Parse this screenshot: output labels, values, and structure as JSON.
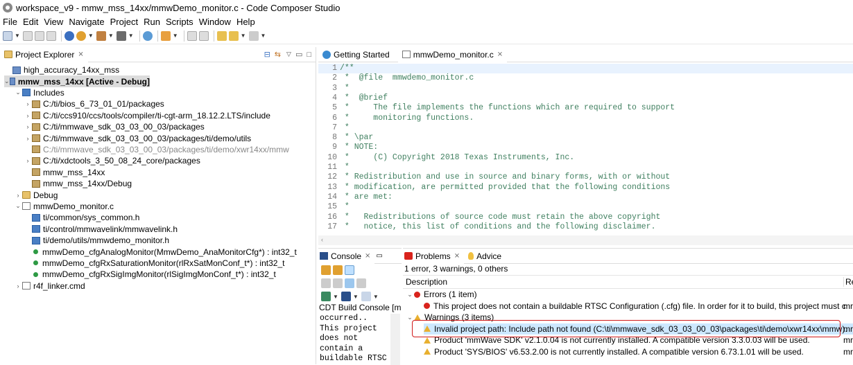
{
  "window": {
    "title": "workspace_v9 - mmw_mss_14xx/mmwDemo_monitor.c - Code Composer Studio"
  },
  "menu": [
    "File",
    "Edit",
    "View",
    "Navigate",
    "Project",
    "Run",
    "Scripts",
    "Window",
    "Help"
  ],
  "project_explorer": {
    "title": "Project Explorer",
    "items": [
      {
        "label": "high_accuracy_14xx_mss",
        "indent": 0,
        "arrow": "",
        "icon": "proj"
      },
      {
        "label": "mmw_mss_14xx  [Active - Debug]",
        "indent": 0,
        "arrow": "v",
        "icon": "proj",
        "bold": true
      },
      {
        "label": "Includes",
        "indent": 1,
        "arrow": "v",
        "icon": "inc"
      },
      {
        "label": "C:/ti/bios_6_73_01_01/packages",
        "indent": 2,
        "arrow": ">",
        "icon": "lib"
      },
      {
        "label": "C:/ti/ccs910/ccs/tools/compiler/ti-cgt-arm_18.12.2.LTS/include",
        "indent": 2,
        "arrow": ">",
        "icon": "lib"
      },
      {
        "label": "C:/ti/mmwave_sdk_03_03_00_03/packages",
        "indent": 2,
        "arrow": ">",
        "icon": "lib"
      },
      {
        "label": "C:/ti/mmwave_sdk_03_03_00_03/packages/ti/demo/utils",
        "indent": 2,
        "arrow": ">",
        "icon": "lib"
      },
      {
        "label": "C:/ti/mmwave_sdk_03_03_00_03/packages/ti/demo/xwr14xx/mmw",
        "indent": 2,
        "arrow": "",
        "icon": "lib",
        "grey": true
      },
      {
        "label": "C:/ti/xdctools_3_50_08_24_core/packages",
        "indent": 2,
        "arrow": ">",
        "icon": "lib"
      },
      {
        "label": "mmw_mss_14xx",
        "indent": 2,
        "arrow": "",
        "icon": "lib"
      },
      {
        "label": "mmw_mss_14xx/Debug",
        "indent": 2,
        "arrow": "",
        "icon": "lib"
      },
      {
        "label": "Debug",
        "indent": 1,
        "arrow": ">",
        "icon": "folder"
      },
      {
        "label": "mmwDemo_monitor.c",
        "indent": 1,
        "arrow": "v",
        "icon": "file"
      },
      {
        "label": "ti/common/sys_common.h",
        "indent": 2,
        "arrow": "",
        "icon": "inc"
      },
      {
        "label": "ti/control/mmwavelink/mmwavelink.h",
        "indent": 2,
        "arrow": "",
        "icon": "inc"
      },
      {
        "label": "ti/demo/utils/mmwdemo_monitor.h",
        "indent": 2,
        "arrow": "",
        "icon": "inc"
      },
      {
        "label": "mmwDemo_cfgAnalogMonitor(MmwDemo_AnaMonitorCfg*) : int32_t",
        "indent": 2,
        "arrow": "",
        "icon": "dot"
      },
      {
        "label": "mmwDemo_cfgRxSaturationMonitor(rlRxSatMonConf_t*) : int32_t",
        "indent": 2,
        "arrow": "",
        "icon": "dot"
      },
      {
        "label": "mmwDemo_cfgRxSigImgMonitor(rlSigImgMonConf_t*) : int32_t",
        "indent": 2,
        "arrow": "",
        "icon": "dot"
      },
      {
        "label": "r4f_linker.cmd",
        "indent": 1,
        "arrow": ">",
        "icon": "file"
      }
    ]
  },
  "editor": {
    "tabs": [
      {
        "label": "Getting Started"
      },
      {
        "label": "mmwDemo_monitor.c"
      }
    ],
    "lines": [
      {
        "n": "1",
        "t": "/**"
      },
      {
        "n": "2",
        "t": " *  @file  mmwdemo_monitor.c"
      },
      {
        "n": "3",
        "t": " *"
      },
      {
        "n": "4",
        "t": " *  @brief"
      },
      {
        "n": "5",
        "t": " *     The file implements the functions which are required to support"
      },
      {
        "n": "6",
        "t": " *     monitoring functions."
      },
      {
        "n": "7",
        "t": " *"
      },
      {
        "n": "8",
        "t": " * \\par"
      },
      {
        "n": "9",
        "t": " * NOTE:"
      },
      {
        "n": "10",
        "t": " *     (C) Copyright 2018 Texas Instruments, Inc."
      },
      {
        "n": "11",
        "t": " *"
      },
      {
        "n": "12",
        "t": " * Redistribution and use in source and binary forms, with or without"
      },
      {
        "n": "13",
        "t": " * modification, are permitted provided that the following conditions"
      },
      {
        "n": "14",
        "t": " * are met:"
      },
      {
        "n": "15",
        "t": " *"
      },
      {
        "n": "16",
        "t": " *   Redistributions of source code must retain the above copyright"
      },
      {
        "n": "17",
        "t": " *   notice, this list of conditions and the following disclaimer."
      }
    ]
  },
  "console": {
    "title": "Console",
    "name": "CDT Build Console [mm",
    "text": "occurred..\nThis project\ndoes not\ncontain a\nbuildable RTSC"
  },
  "problems": {
    "tabs": [
      {
        "label": "Problems"
      },
      {
        "label": "Advice"
      }
    ],
    "summary": "1 error, 3 warnings, 0 others",
    "col_description": "Description",
    "col_resource": "Re",
    "rows": [
      {
        "kind": "group",
        "arrow": "v",
        "icon": "err",
        "text": "Errors (1 item)",
        "res": ""
      },
      {
        "kind": "item",
        "icon": "err",
        "text": "This project does not contain a buildable RTSC Configuration (.cfg) file. In order for it to build, this project must c",
        "res": "mr"
      },
      {
        "kind": "group",
        "arrow": "v",
        "icon": "warn",
        "text": "Warnings (3 items)",
        "res": ""
      },
      {
        "kind": "item",
        "icon": "warn",
        "text": "Invalid project path: Include path not found (C:\\ti\\mmwave_sdk_03_03_00_03\\packages\\ti\\demo\\xwr14xx\\mmw).",
        "res": "mr",
        "selected": true
      },
      {
        "kind": "item",
        "icon": "warn",
        "text": "Product 'mmWave SDK' v2.1.0.04 is not currently installed. A compatible version 3.3.0.03 will be used.",
        "res": "mr"
      },
      {
        "kind": "item",
        "icon": "warn",
        "text": "Product 'SYS/BIOS' v6.53.2.00 is not currently installed. A compatible version 6.73.1.01 will be used.",
        "res": "mr"
      }
    ]
  },
  "colors": {
    "selection": "#cde8ff",
    "highlight_box": "#d01818",
    "comment": "#3f7f5f"
  }
}
